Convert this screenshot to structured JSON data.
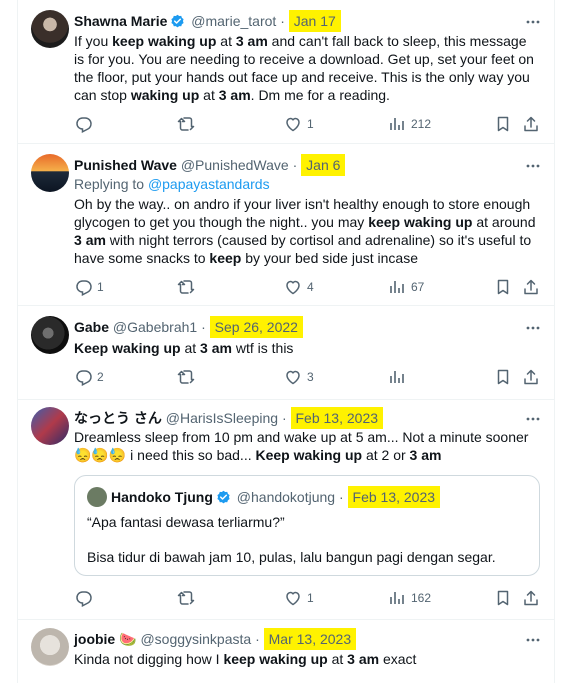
{
  "tweets": [
    {
      "name": "Shawna Marie",
      "verified": true,
      "handle": "@marie_tarot",
      "date": "Jan 17",
      "body_parts": [
        "If you ",
        "keep waking up",
        " at ",
        "3 am",
        " and can't fall back to sleep, this message is for you. You are needing to receive a download. Get up, set your feet on the floor, put your hands out face up and receive. This is the only way you can stop ",
        "waking up",
        " at ",
        "3 am",
        ". Dm me for a reading."
      ],
      "counts": {
        "replies": "",
        "reposts": "",
        "likes": "1",
        "views": "212"
      }
    },
    {
      "name": "Punished Wave",
      "handle": "@PunishedWave",
      "date": "Jan 6",
      "replying_to_label": "Replying to",
      "replying_to": "@papayastandards",
      "body_parts": [
        "Oh by the way.. on andro if your liver isn't healthy enough to store enough glycogen to get you though the night.. you may ",
        "keep waking up",
        " at around ",
        "3",
        " ",
        "am",
        " with night terrors (caused by cortisol and adrenaline) so it's useful to have some snacks to ",
        "keep",
        " by your bed side just incase"
      ],
      "counts": {
        "replies": "1",
        "reposts": "",
        "likes": "4",
        "views": "67"
      }
    },
    {
      "name": "Gabe",
      "handle": "@Gabebrah1",
      "date": "Sep 26, 2022",
      "body_parts": [
        "Keep waking up",
        " at ",
        "3 am",
        " wtf is this"
      ],
      "counts": {
        "replies": "2",
        "reposts": "",
        "likes": "3",
        "views": ""
      }
    },
    {
      "name": "なっとう さん",
      "handle": "@HarisIsSleeping",
      "date": "Feb 13, 2023",
      "body_parts": [
        "Dreamless sleep from 10 pm and wake up at 5 am... Not a minute sooner ",
        "😓😓😓",
        " i need this so bad... ",
        "Keep waking up",
        " at 2 or ",
        "3 am"
      ],
      "quote": {
        "name": "Handoko Tjung",
        "verified": true,
        "handle": "@handokotjung",
        "date": "Feb 13, 2023",
        "line1": "“Apa fantasi dewasa terliarmu?”",
        "line2": "Bisa tidur di bawah jam 10, pulas, lalu bangun pagi dengan segar."
      },
      "counts": {
        "replies": "",
        "reposts": "",
        "likes": "1",
        "views": "162"
      }
    },
    {
      "name": "joobie",
      "name_emoji": "🍉",
      "handle": "@soggysinkpasta",
      "date": "Mar 13, 2023",
      "body_parts": [
        "Kinda not digging how I ",
        "keep waking up",
        " at ",
        "3 am",
        " exact"
      ]
    }
  ],
  "separator_dot": "·",
  "icons": [
    "more-icon",
    "reply-icon",
    "repost-icon",
    "like-icon",
    "views-icon",
    "bookmark-icon",
    "share-icon",
    "verified-icon"
  ],
  "colors": {
    "text": "#0f1419",
    "muted": "#536471",
    "link": "#1d9bf0",
    "highlight": "#fff200",
    "border": "#eff3f4"
  }
}
